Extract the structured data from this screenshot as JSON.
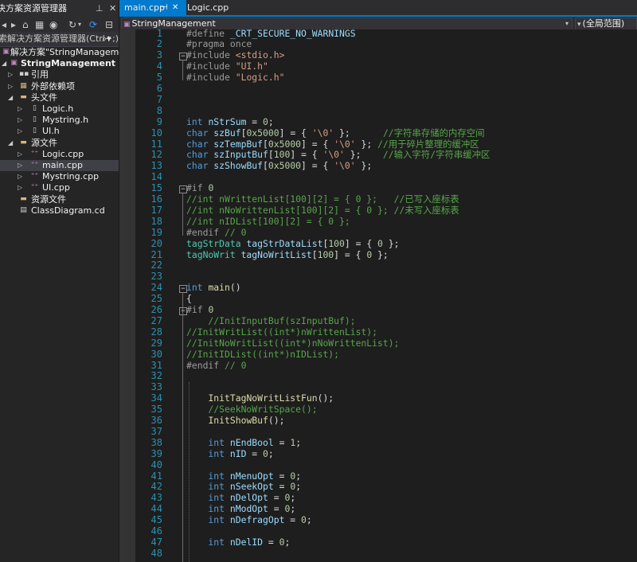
{
  "solution_explorer": {
    "title": "决方案资源管理器",
    "search_placeholder": "索解决方案资源管理器(Ctrl+;)",
    "tree": [
      {
        "label": "解决方案\"StringManagement\"(1",
        "depth": 0,
        "arrow": "none",
        "icon": "solution-icon"
      },
      {
        "label": "StringManagement",
        "depth": 0,
        "arrow": "expanded",
        "icon": "cpp-project-icon"
      },
      {
        "label": "引用",
        "depth": 1,
        "arrow": "collapsed",
        "icon": "references-icon"
      },
      {
        "label": "外部依赖项",
        "depth": 1,
        "arrow": "collapsed",
        "icon": "external-deps-icon"
      },
      {
        "label": "头文件",
        "depth": 1,
        "arrow": "expanded",
        "icon": "folder-icon"
      },
      {
        "label": "Logic.h",
        "depth": 2,
        "arrow": "collapsed",
        "icon": "header-file-icon"
      },
      {
        "label": "Mystring.h",
        "depth": 2,
        "arrow": "collapsed",
        "icon": "header-file-icon"
      },
      {
        "label": "UI.h",
        "depth": 2,
        "arrow": "collapsed",
        "icon": "header-file-icon"
      },
      {
        "label": "源文件",
        "depth": 1,
        "arrow": "expanded",
        "icon": "folder-icon"
      },
      {
        "label": "Logic.cpp",
        "depth": 2,
        "arrow": "collapsed",
        "icon": "cpp-file-icon"
      },
      {
        "label": "main.cpp",
        "depth": 2,
        "arrow": "collapsed",
        "icon": "cpp-file-icon",
        "selected": true
      },
      {
        "label": "Mystring.cpp",
        "depth": 2,
        "arrow": "collapsed",
        "icon": "cpp-file-icon"
      },
      {
        "label": "UI.cpp",
        "depth": 2,
        "arrow": "collapsed",
        "icon": "cpp-file-icon"
      },
      {
        "label": "资源文件",
        "depth": 1,
        "arrow": "none",
        "icon": "folder-icon"
      },
      {
        "label": "ClassDiagram.cd",
        "depth": 1,
        "arrow": "none",
        "icon": "class-diagram-icon"
      }
    ]
  },
  "editor": {
    "tabs": [
      {
        "label": "main.cpp",
        "active": true
      },
      {
        "label": "Logic.cpp",
        "active": false
      }
    ],
    "nav_left": "StringManagement",
    "nav_right": "(全局范围)",
    "colors": {
      "accent": "#007acc",
      "keyword": "#569cd6",
      "comment": "#57a64a",
      "string": "#d69d85",
      "function": "#dcdcaa",
      "type": "#4ec9b0",
      "number": "#b5cea8",
      "line_number": "#2b91af"
    },
    "lines": [
      {
        "n": "1",
        "tokens": [
          [
            "pp",
            "#define "
          ],
          [
            "var",
            "_CRT_SECURE_NO_WARNINGS"
          ]
        ]
      },
      {
        "n": "2",
        "tokens": [
          [
            "pp",
            "#pragma once"
          ]
        ]
      },
      {
        "n": "3",
        "tokens": [
          [
            "pp",
            "#include "
          ],
          [
            "str",
            "<stdio.h>"
          ]
        ]
      },
      {
        "n": "4",
        "tokens": [
          [
            "pp",
            "#include "
          ],
          [
            "str",
            "\"UI.h\""
          ]
        ]
      },
      {
        "n": "5",
        "tokens": [
          [
            "pp",
            "#include "
          ],
          [
            "str",
            "\"Logic.h\""
          ]
        ]
      },
      {
        "n": "6",
        "tokens": []
      },
      {
        "n": "7",
        "tokens": []
      },
      {
        "n": "8",
        "tokens": []
      },
      {
        "n": "9",
        "tokens": [
          [
            "kw",
            "int "
          ],
          [
            "var",
            "nStrSum"
          ],
          [
            "id",
            " = "
          ],
          [
            "num",
            "0"
          ],
          [
            "id",
            ";"
          ]
        ]
      },
      {
        "n": "10",
        "tokens": [
          [
            "kw",
            "char "
          ],
          [
            "var",
            "szBuf"
          ],
          [
            "id",
            "["
          ],
          [
            "num",
            "0x5000"
          ],
          [
            "id",
            "] = { "
          ],
          [
            "str",
            "'\\0'"
          ],
          [
            "id",
            " };      "
          ],
          [
            "cm",
            "//字符串存储的内存空间"
          ]
        ]
      },
      {
        "n": "11",
        "tokens": [
          [
            "kw",
            "char "
          ],
          [
            "var",
            "szTempBuf"
          ],
          [
            "id",
            "["
          ],
          [
            "num",
            "0x5000"
          ],
          [
            "id",
            "] = { "
          ],
          [
            "str",
            "'\\0'"
          ],
          [
            "id",
            " }; "
          ],
          [
            "cm",
            "//用于碎片整理的缓冲区"
          ]
        ]
      },
      {
        "n": "12",
        "tokens": [
          [
            "kw",
            "char "
          ],
          [
            "var",
            "szInputBuf"
          ],
          [
            "id",
            "["
          ],
          [
            "num",
            "100"
          ],
          [
            "id",
            "] = { "
          ],
          [
            "str",
            "'\\0'"
          ],
          [
            "id",
            " };    "
          ],
          [
            "cm",
            "//输入字符/字符串缓冲区"
          ]
        ]
      },
      {
        "n": "13",
        "tokens": [
          [
            "kw",
            "char "
          ],
          [
            "var",
            "szShowBuf"
          ],
          [
            "id",
            "["
          ],
          [
            "num",
            "0x5000"
          ],
          [
            "id",
            "] = { "
          ],
          [
            "str",
            "'\\0'"
          ],
          [
            "id",
            " };"
          ]
        ]
      },
      {
        "n": "14",
        "tokens": []
      },
      {
        "n": "15",
        "tokens": [
          [
            "pp",
            "#if "
          ],
          [
            "num",
            "0"
          ]
        ]
      },
      {
        "n": "16",
        "tokens": [
          [
            "cm",
            "//int nWrittenList[100][2] = { 0 };   //已写入座标表"
          ]
        ]
      },
      {
        "n": "17",
        "tokens": [
          [
            "cm",
            "//int nNoWrittenList[100][2] = { 0 }; //未写入座标表"
          ]
        ]
      },
      {
        "n": "18",
        "tokens": [
          [
            "cm",
            "//int nIDList[100][2] = { 0 };"
          ]
        ]
      },
      {
        "n": "19",
        "tokens": [
          [
            "pp",
            "#endif "
          ],
          [
            "cm",
            "// 0"
          ]
        ]
      },
      {
        "n": "20",
        "tokens": [
          [
            "ty",
            "tagStrData "
          ],
          [
            "var",
            "tagStrDataList"
          ],
          [
            "id",
            "["
          ],
          [
            "num",
            "100"
          ],
          [
            "id",
            "] = { "
          ],
          [
            "num",
            "0"
          ],
          [
            "id",
            " };"
          ]
        ]
      },
      {
        "n": "21",
        "tokens": [
          [
            "ty",
            "tagNoWrit "
          ],
          [
            "var",
            "tagNoWritList"
          ],
          [
            "id",
            "["
          ],
          [
            "num",
            "100"
          ],
          [
            "id",
            "] = { "
          ],
          [
            "num",
            "0"
          ],
          [
            "id",
            " };"
          ]
        ]
      },
      {
        "n": "22",
        "tokens": []
      },
      {
        "n": "23",
        "tokens": []
      },
      {
        "n": "24",
        "tokens": [
          [
            "kw",
            "int "
          ],
          [
            "fn",
            "main"
          ],
          [
            "id",
            "()"
          ]
        ]
      },
      {
        "n": "25",
        "tokens": [
          [
            "id",
            "{"
          ]
        ]
      },
      {
        "n": "26",
        "tokens": [
          [
            "pp",
            "#if "
          ],
          [
            "num",
            "0"
          ]
        ]
      },
      {
        "n": "27",
        "tokens": [
          [
            "cm",
            "    //InitInputBuf(szInputBuf);"
          ]
        ]
      },
      {
        "n": "28",
        "tokens": [
          [
            "cm",
            "//InitWritList((int*)nWrittenList);"
          ]
        ]
      },
      {
        "n": "29",
        "tokens": [
          [
            "cm",
            "//InitNoWritList((int*)nNoWrittenList);"
          ]
        ]
      },
      {
        "n": "30",
        "tokens": [
          [
            "cm",
            "//InitIDList((int*)nIDList);"
          ]
        ]
      },
      {
        "n": "31",
        "tokens": [
          [
            "pp",
            "#endif "
          ],
          [
            "cm",
            "// 0"
          ]
        ]
      },
      {
        "n": "32",
        "tokens": []
      },
      {
        "n": "33",
        "tokens": []
      },
      {
        "n": "34",
        "tokens": [
          [
            "id",
            "    "
          ],
          [
            "fn",
            "InitTagNoWritListFun"
          ],
          [
            "id",
            "();"
          ]
        ]
      },
      {
        "n": "35",
        "tokens": [
          [
            "cm",
            "    //SeekNoWritSpace();"
          ]
        ]
      },
      {
        "n": "36",
        "tokens": [
          [
            "id",
            "    "
          ],
          [
            "fn",
            "InitShowBuf"
          ],
          [
            "id",
            "();"
          ]
        ]
      },
      {
        "n": "37",
        "tokens": []
      },
      {
        "n": "38",
        "tokens": [
          [
            "kw",
            "    int "
          ],
          [
            "var",
            "nEndBool"
          ],
          [
            "id",
            " = "
          ],
          [
            "num",
            "1"
          ],
          [
            "id",
            ";"
          ]
        ]
      },
      {
        "n": "39",
        "tokens": [
          [
            "kw",
            "    int "
          ],
          [
            "var",
            "nID"
          ],
          [
            "id",
            " = "
          ],
          [
            "num",
            "0"
          ],
          [
            "id",
            ";"
          ]
        ]
      },
      {
        "n": "40",
        "tokens": []
      },
      {
        "n": "41",
        "tokens": [
          [
            "kw",
            "    int "
          ],
          [
            "var",
            "nMenuOpt"
          ],
          [
            "id",
            " = "
          ],
          [
            "num",
            "0"
          ],
          [
            "id",
            ";"
          ]
        ]
      },
      {
        "n": "42",
        "tokens": [
          [
            "kw",
            "    int "
          ],
          [
            "var",
            "nSeekOpt"
          ],
          [
            "id",
            " = "
          ],
          [
            "num",
            "0"
          ],
          [
            "id",
            ";"
          ]
        ]
      },
      {
        "n": "43",
        "tokens": [
          [
            "kw",
            "    int "
          ],
          [
            "var",
            "nDelOpt"
          ],
          [
            "id",
            " = "
          ],
          [
            "num",
            "0"
          ],
          [
            "id",
            ";"
          ]
        ]
      },
      {
        "n": "44",
        "tokens": [
          [
            "kw",
            "    int "
          ],
          [
            "var",
            "nModOpt"
          ],
          [
            "id",
            " = "
          ],
          [
            "num",
            "0"
          ],
          [
            "id",
            ";"
          ]
        ]
      },
      {
        "n": "45",
        "tokens": [
          [
            "kw",
            "    int "
          ],
          [
            "var",
            "nDefragOpt"
          ],
          [
            "id",
            " = "
          ],
          [
            "num",
            "0"
          ],
          [
            "id",
            ";"
          ]
        ]
      },
      {
        "n": "46",
        "tokens": []
      },
      {
        "n": "47",
        "tokens": [
          [
            "kw",
            "    int "
          ],
          [
            "var",
            "nDelID"
          ],
          [
            "id",
            " = "
          ],
          [
            "num",
            "0"
          ],
          [
            "id",
            ";"
          ]
        ]
      },
      {
        "n": "48",
        "tokens": []
      }
    ]
  }
}
